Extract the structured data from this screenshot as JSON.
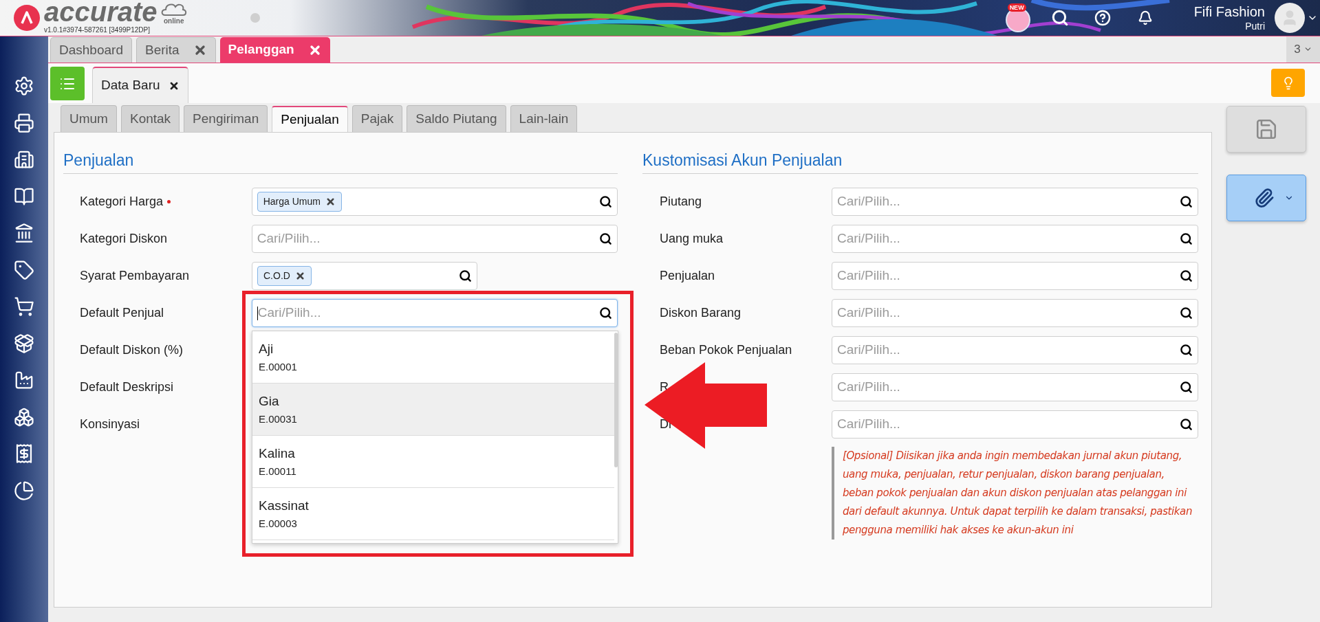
{
  "app": {
    "logo": "accurate",
    "logo_sub": "online",
    "version": "v1.0.1#3974-587261 [3499P12DP]"
  },
  "header": {
    "new_badge": "NEW",
    "company": "Fifi Fashion",
    "user": "Putri"
  },
  "tabs": [
    {
      "label": "Dashboard",
      "selected": false,
      "closable": false
    },
    {
      "label": "Berita",
      "selected": false,
      "closable": true
    },
    {
      "label": "Pelanggan",
      "selected": true,
      "closable": true
    }
  ],
  "tab_count": "3",
  "sub_tabs": [
    {
      "label": "Data Baru",
      "selected": true
    }
  ],
  "form_tabs": [
    {
      "label": "Umum",
      "selected": false
    },
    {
      "label": "Kontak",
      "selected": false
    },
    {
      "label": "Pengiriman",
      "selected": false
    },
    {
      "label": "Penjualan",
      "selected": true
    },
    {
      "label": "Pajak",
      "selected": false
    },
    {
      "label": "Saldo Piutang",
      "selected": false
    },
    {
      "label": "Lain-lain",
      "selected": false
    }
  ],
  "penjualan": {
    "title": "Penjualan",
    "fields": [
      {
        "label": "Kategori Harga",
        "required": true,
        "kind": "search",
        "tag": "Harga Umum",
        "focused": false
      },
      {
        "label": "Kategori Diskon",
        "required": false,
        "kind": "search",
        "placeholder": "Cari/Pilih...",
        "focused": false
      },
      {
        "label": "Syarat Pembayaran",
        "required": false,
        "kind": "search_short",
        "tag": "C.O.D",
        "focused": false
      },
      {
        "label": "Default Penjual",
        "required": false,
        "kind": "search",
        "placeholder": "Cari/Pilih...",
        "focused": true
      },
      {
        "label": "Default Diskon (%)",
        "required": false,
        "kind": "label"
      },
      {
        "label": "Default Deskripsi",
        "required": false,
        "kind": "label"
      },
      {
        "label": "Konsinyasi",
        "required": false,
        "kind": "label"
      }
    ],
    "dropdown": [
      {
        "name": "Aji",
        "code": "E.00001",
        "selected": false
      },
      {
        "name": "Gia",
        "code": "E.00031",
        "selected": true
      },
      {
        "name": "Kalina",
        "code": "E.00011",
        "selected": false
      },
      {
        "name": "Kassinat",
        "code": "E.00003",
        "selected": false
      }
    ]
  },
  "kustomisasi": {
    "title": "Kustomisasi Akun Penjualan",
    "fields": [
      {
        "label": "Piutang",
        "placeholder": "Cari/Pilih..."
      },
      {
        "label": "Uang muka",
        "placeholder": "Cari/Pilih..."
      },
      {
        "label": "Penjualan",
        "placeholder": "Cari/Pilih..."
      },
      {
        "label": "Diskon Barang",
        "placeholder": "Cari/Pilih..."
      },
      {
        "label": "Beban Pokok Penjualan",
        "placeholder": "Cari/Pilih..."
      },
      {
        "label": "R",
        "placeholder": "Cari/Pilih..."
      },
      {
        "label": "Di",
        "placeholder": "Cari/Pilih..."
      }
    ],
    "note": "[Opsional] Diisikan jika anda ingin membedakan jurnal akun piutang, uang muka, penjualan, retur penjualan, diskon barang penjualan, beban pokok penjualan dan akun diskon penjualan atas pelanggan ini dari default akunnya. Untuk dapat terpilih ke dalam transaksi, pastikan pengguna memiliki hak akses ke akun-akun ini"
  }
}
